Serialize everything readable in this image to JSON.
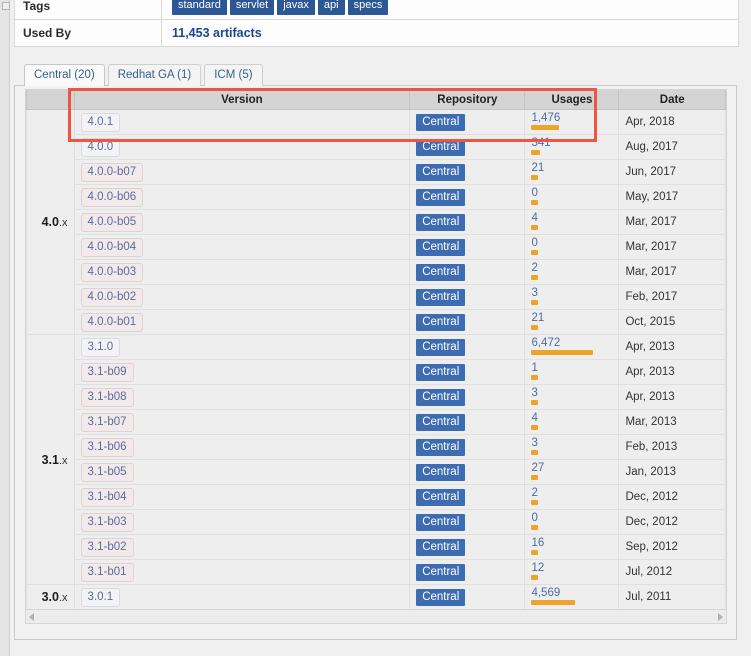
{
  "info_rows": [
    {
      "label": "Tags",
      "type": "tags",
      "tags": [
        "standard",
        "servlet",
        "javax",
        "api",
        "specs"
      ]
    },
    {
      "label": "Used By",
      "type": "link",
      "value": "11,453 artifacts"
    }
  ],
  "tabs": [
    {
      "label": "Central (20)",
      "active": true
    },
    {
      "label": "Redhat GA (1)",
      "active": false
    },
    {
      "label": "ICM (5)",
      "active": false
    }
  ],
  "table": {
    "headers": [
      "",
      "Version",
      "Repository",
      "Usages",
      "Date"
    ],
    "groups": [
      {
        "label_bold": "4.0",
        "label_suffix": ".x",
        "rows": [
          {
            "version": "4.0.1",
            "plain": true,
            "repository": "Central",
            "usages": "1,476",
            "bar": 28,
            "date": "Apr, 2018"
          },
          {
            "version": "4.0.0",
            "plain": true,
            "repository": "Central",
            "usages": "341",
            "bar": 9,
            "date": "Aug, 2017"
          },
          {
            "version": "4.0.0-b07",
            "plain": false,
            "repository": "Central",
            "usages": "21",
            "bar": 7,
            "date": "Jun, 2017"
          },
          {
            "version": "4.0.0-b06",
            "plain": false,
            "repository": "Central",
            "usages": "0",
            "bar": 7,
            "date": "May, 2017"
          },
          {
            "version": "4.0.0-b05",
            "plain": false,
            "repository": "Central",
            "usages": "4",
            "bar": 7,
            "date": "Mar, 2017"
          },
          {
            "version": "4.0.0-b04",
            "plain": false,
            "repository": "Central",
            "usages": "0",
            "bar": 7,
            "date": "Mar, 2017"
          },
          {
            "version": "4.0.0-b03",
            "plain": false,
            "repository": "Central",
            "usages": "2",
            "bar": 7,
            "date": "Mar, 2017"
          },
          {
            "version": "4.0.0-b02",
            "plain": false,
            "repository": "Central",
            "usages": "3",
            "bar": 7,
            "date": "Feb, 2017"
          },
          {
            "version": "4.0.0-b01",
            "plain": false,
            "repository": "Central",
            "usages": "21",
            "bar": 7,
            "date": "Oct, 2015"
          }
        ]
      },
      {
        "label_bold": "3.1",
        "label_suffix": ".x",
        "rows": [
          {
            "version": "3.1.0",
            "plain": true,
            "repository": "Central",
            "usages": "6,472",
            "bar": 62,
            "date": "Apr, 2013"
          },
          {
            "version": "3.1-b09",
            "plain": false,
            "repository": "Central",
            "usages": "1",
            "bar": 7,
            "date": "Apr, 2013"
          },
          {
            "version": "3.1-b08",
            "plain": false,
            "repository": "Central",
            "usages": "3",
            "bar": 7,
            "date": "Apr, 2013"
          },
          {
            "version": "3.1-b07",
            "plain": false,
            "repository": "Central",
            "usages": "4",
            "bar": 7,
            "date": "Mar, 2013"
          },
          {
            "version": "3.1-b06",
            "plain": false,
            "repository": "Central",
            "usages": "3",
            "bar": 7,
            "date": "Feb, 2013"
          },
          {
            "version": "3.1-b05",
            "plain": false,
            "repository": "Central",
            "usages": "27",
            "bar": 7,
            "date": "Jan, 2013"
          },
          {
            "version": "3.1-b04",
            "plain": false,
            "repository": "Central",
            "usages": "2",
            "bar": 7,
            "date": "Dec, 2012"
          },
          {
            "version": "3.1-b03",
            "plain": false,
            "repository": "Central",
            "usages": "0",
            "bar": 7,
            "date": "Dec, 2012"
          },
          {
            "version": "3.1-b02",
            "plain": false,
            "repository": "Central",
            "usages": "16",
            "bar": 7,
            "date": "Sep, 2012"
          },
          {
            "version": "3.1-b01",
            "plain": false,
            "repository": "Central",
            "usages": "12",
            "bar": 7,
            "date": "Jul, 2012"
          }
        ]
      },
      {
        "label_bold": "3.0",
        "label_suffix": ".x",
        "rows": [
          {
            "version": "3.0.1",
            "plain": true,
            "repository": "Central",
            "usages": "4,569",
            "bar": 44,
            "date": "Jul, 2011"
          }
        ]
      }
    ]
  },
  "scrollbar": {
    "left_arrow": "◂",
    "right_arrow": "▸"
  },
  "colors": {
    "tag_blue": "#2b5797",
    "repo_blue": "#3d6cb0",
    "usage_orange": "#f0a32a",
    "link_blue": "#4a6ea8",
    "annotation_red": "#ee5544"
  }
}
